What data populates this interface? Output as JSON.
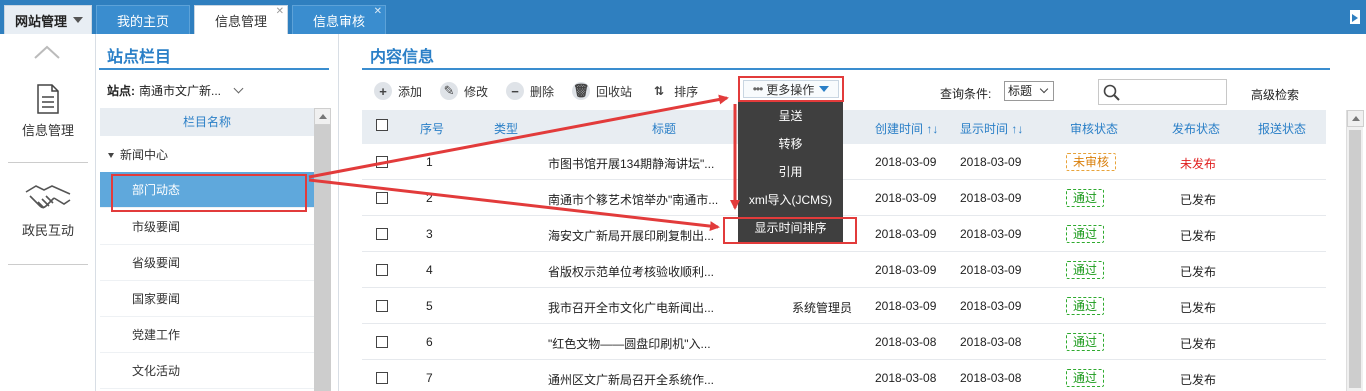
{
  "topbar": {
    "site_menu": "网站管理",
    "tabs": [
      {
        "label": "我的主页"
      },
      {
        "label": "信息管理"
      },
      {
        "label": "信息审核"
      }
    ]
  },
  "leftnav": {
    "items": [
      {
        "label": "信息管理",
        "icon": "document-icon"
      },
      {
        "label": "政民互动",
        "icon": "handshake-icon"
      }
    ]
  },
  "column_panel": {
    "title": "站点栏目",
    "station_label": "站点:",
    "station_value": "南通市文广新...",
    "tree_header": "栏目名称",
    "root": "新闻中心",
    "items": [
      "部门动态",
      "市级要闻",
      "省级要闻",
      "国家要闻",
      "党建工作",
      "文化活动"
    ],
    "selected": "部门动态"
  },
  "content": {
    "title": "内容信息",
    "toolbar": {
      "add": "添加",
      "edit": "修改",
      "delete": "删除",
      "recycle": "回收站",
      "sort": "排序",
      "more": "更多操作"
    },
    "query_label": "查询条件:",
    "query_select": "标题",
    "search_placeholder": "",
    "advanced_search": "高级检索",
    "columns": {
      "no": "序号",
      "type": "类型",
      "title": "标题",
      "created": "创建时间 ↑↓",
      "shown": "显示时间 ↑↓",
      "review": "审核状态",
      "publish": "发布状态",
      "report": "报送状态"
    },
    "rows": [
      {
        "no": "1",
        "type": "",
        "title": "市图书馆开展134期静海讲坛\"...",
        "author": "",
        "created": "2018-03-09",
        "shown": "2018-03-09",
        "review": "未审核",
        "publish": "未发布"
      },
      {
        "no": "2",
        "type": "",
        "title": "南通市个簃艺术馆举办\"南通市...",
        "author": "",
        "created": "2018-03-09",
        "shown": "2018-03-09",
        "review": "通过",
        "publish": "已发布"
      },
      {
        "no": "3",
        "type": "",
        "title": "海安文广新局开展印刷复制出...",
        "author": "",
        "created": "2018-03-09",
        "shown": "2018-03-09",
        "review": "通过",
        "publish": "已发布"
      },
      {
        "no": "4",
        "type": "",
        "title": "省版权示范单位考核验收顺利...",
        "author": "",
        "created": "2018-03-09",
        "shown": "2018-03-09",
        "review": "通过",
        "publish": "已发布"
      },
      {
        "no": "5",
        "type": "",
        "title": "我市召开全市文化广电新闻出...",
        "author": "系统管理员",
        "created": "2018-03-09",
        "shown": "2018-03-09",
        "review": "通过",
        "publish": "已发布"
      },
      {
        "no": "6",
        "type": "",
        "title": "\"红色文物——圆盘印刷机\"入...",
        "author": "",
        "created": "2018-03-08",
        "shown": "2018-03-08",
        "review": "通过",
        "publish": "已发布"
      },
      {
        "no": "7",
        "type": "",
        "title": "通州区文广新局召开全系统作...",
        "author": "",
        "created": "2018-03-08",
        "shown": "2018-03-08",
        "review": "通过",
        "publish": "已发布"
      }
    ]
  },
  "dropdown": {
    "items": [
      "呈送",
      "转移",
      "引用",
      "xml导入(JCMS)",
      "显示时间排序"
    ]
  },
  "colors": {
    "topbar": "#2f7fbf",
    "accent": "#2a7fc7",
    "selected_row": "#5fa8dc",
    "dropdown_bg": "#3f3f3f",
    "highlight_red": "#e23b3b",
    "pass_green": "#1a9a1a",
    "pending_orange": "#d97f0b",
    "unpublished_red": "#e02020"
  }
}
